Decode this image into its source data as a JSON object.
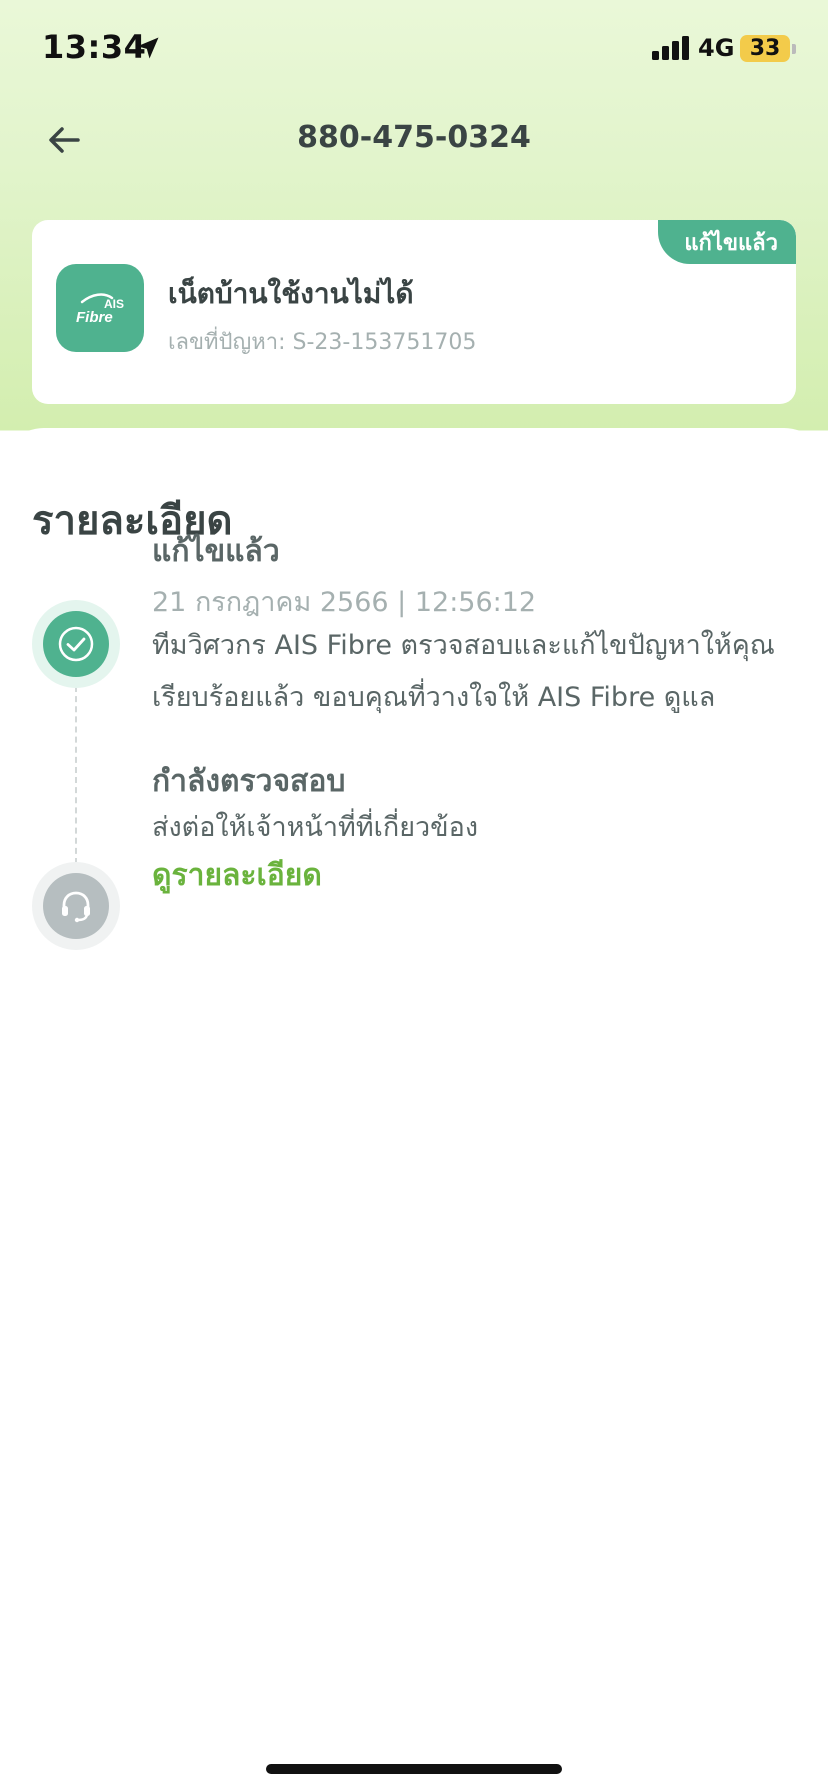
{
  "status_bar": {
    "time": "13:34",
    "network": "4G",
    "battery": "33",
    "battery_color": "#f3cb4a"
  },
  "header": {
    "title": "880-475-0324",
    "back_icon": "arrow-left-icon"
  },
  "ticket": {
    "status_tag": "แก้ไขแล้ว",
    "title": "เน็ตบ้านใช้งานไม่ได้",
    "number": "เลขที่ปัญหา: S-23-153751705",
    "logo": {
      "brand_top": "AIS",
      "brand_bottom": "Fibre",
      "color": "#4fb28f"
    }
  },
  "details": {
    "title": "รายละเอียด",
    "steps": [
      {
        "icon": "check-circle-icon",
        "title": "แก้ไขแล้ว",
        "date": "21 กรกฎาคม 2566 | 12:56:12",
        "description": "ทีมวิศวกร AIS Fibre ตรวจสอบและแก้ไขปัญหาให้คุณเรียบร้อยแล้ว ขอบคุณที่วางใจให้ AIS Fibre ดูแล"
      },
      {
        "icon": "headset-icon",
        "title": "กำลังตรวจสอบ",
        "description": "ส่งต่อให้เจ้าหน้าที่ที่เกี่ยวข้อง",
        "link": "ดูรายละเอียด"
      }
    ]
  },
  "colors": {
    "accent": "#4fb28f",
    "link": "#6ab33d",
    "text_dark": "#3a4444",
    "text_muted": "#a5b0b0"
  }
}
